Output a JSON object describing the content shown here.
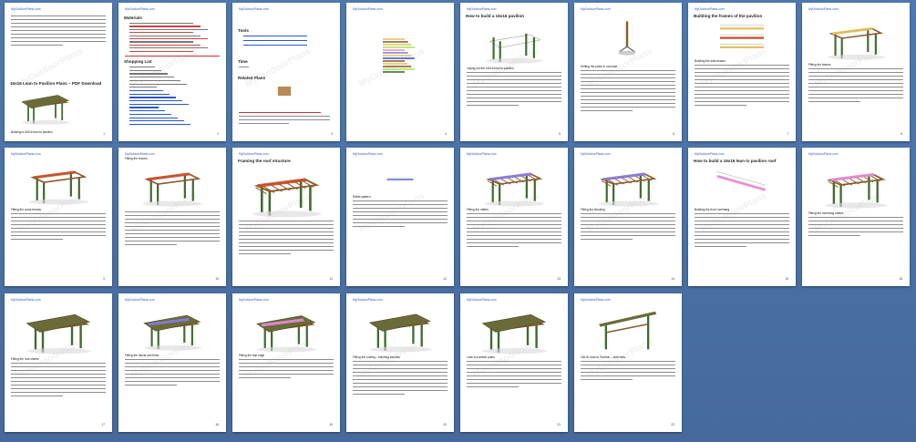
{
  "header_url": "MyOutdoorPlans.com",
  "watermark": "MyOutdoorPlans",
  "colors": {
    "background": "#4a72a6",
    "page": "#ffffff",
    "link": "#2b56c7",
    "wood": "#8a5a2b",
    "roof": "#6b6b3a",
    "highlight_purple": "#8a7be0",
    "highlight_pink": "#e78fd6",
    "highlight_red": "#d43030",
    "highlight_yellow": "#e6c25c",
    "highlight_blue": "#3b55c9"
  },
  "pages": [
    {
      "num": "1",
      "heading": "16x16 Lean to Pavilion Plans – PDF Download",
      "caption": "Building a 16x16 lean to pavilion"
    },
    {
      "num": "2",
      "heading": "Materials",
      "subheading": "Shopping List"
    },
    {
      "num": "3",
      "heading": "Tools",
      "subheading": "Time",
      "subheading2": "Related Plans"
    },
    {
      "num": "4"
    },
    {
      "num": "5",
      "heading": "How to build a 16x16 pavilion",
      "caption": "Laying out the 16x16 lean to pavilion"
    },
    {
      "num": "6",
      "caption": "Setting the posts in concrete"
    },
    {
      "num": "7",
      "heading": "Building the frames of the pavilion",
      "caption": "Building the side beams"
    },
    {
      "num": "8",
      "caption": "Fitting the beams"
    },
    {
      "num": "9",
      "caption": "Fitting the cross beams"
    },
    {
      "num": "10",
      "caption": "Fitting the braces"
    },
    {
      "num": "11",
      "heading": "Framing the roof structure"
    },
    {
      "num": "12",
      "caption": "Rafter pattern"
    },
    {
      "num": "13",
      "caption": "Fitting the rafters"
    },
    {
      "num": "14",
      "caption": "Fitting the blocking"
    },
    {
      "num": "15",
      "heading": "How to build a 16x16 lean to pavilion roof",
      "caption": "Building the front overhang"
    },
    {
      "num": "16",
      "caption": "Fitting the overhang rafters"
    },
    {
      "num": "17",
      "caption": "Fitting the roof sheets"
    },
    {
      "num": "18",
      "caption": "Fitting the fascia and trims"
    },
    {
      "num": "19",
      "caption": "Fitting the drip edge"
    },
    {
      "num": "20",
      "caption": "Fitting the roofing – finishing touches"
    },
    {
      "num": "21",
      "caption": "Lean to pavilion plans"
    },
    {
      "num": "22",
      "caption": "16x16 Lean to Pavilion – side view"
    }
  ]
}
